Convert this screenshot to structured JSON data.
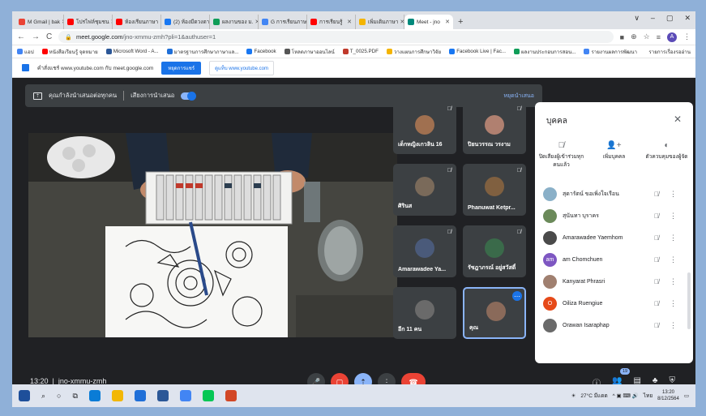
{
  "browser": {
    "tabs": [
      {
        "label": "M Gmail | bak",
        "color": "#ea4335"
      },
      {
        "label": "โปรไฟล์ชุมชน",
        "color": "#ff0000"
      },
      {
        "label": "ห้องเรียนภาษา",
        "color": "#ff0000"
      },
      {
        "label": "(2) ห้องมีดวงดาว",
        "color": "#1877f2"
      },
      {
        "label": "ผลงานของ ม.",
        "color": "#0f9d58"
      },
      {
        "label": "G การเรียนภาษา",
        "color": "#4285f4"
      },
      {
        "label": "การเรียนรู้",
        "color": "#ff0000"
      },
      {
        "label": "เพิ่มเติมภาษา",
        "color": "#f4b400"
      },
      {
        "label": "Meet - jno",
        "color": "#00897b"
      }
    ],
    "new_tab": "+",
    "window_controls": [
      "∨",
      "–",
      "▢",
      "✕"
    ],
    "url_host": "meet.google.com",
    "url_path": "/jno-xmmu-zmh?pli=1&authuser=1",
    "bookmarks": [
      "แอป",
      "หนังสือเรียนรู้ จุดหมาย",
      "Microsoft Word - A...",
      "มาตรฐานการศึกษาภาษาแล...",
      "Facebook",
      "โหลดภาษาออนไลน์",
      "T_0025.PDF",
      "วางแผนการศึกษาวิจัย",
      "Facebook Live | Fac...",
      "ผลงานประกอบการสอน...",
      "รายงานผลการพัฒนา"
    ],
    "reading_list": "รายการเรื่องรออ่าน",
    "infobar": {
      "text": "คำสั่งแชร์ www.youtube.com กับ meet.google.com",
      "switch_label": "หยุดการแชร์",
      "link_label": "ดูแท็บ www.youtube.com"
    }
  },
  "meet": {
    "presenting_text": "คุณกำลังนำเสนอต่อทุกคน",
    "present_option": "เสียงการนำเสนอ",
    "stop_label": "หยุดนำเสนอ",
    "tiles": [
      {
        "name": "เด็กหญิงเกวลิน 16",
        "color": "#a07050"
      },
      {
        "name": "ปิยนวรรณ วรงาม",
        "color": "#b08070"
      },
      {
        "name": "ศิรินส",
        "color": "#7a6a5a"
      },
      {
        "name": "Phanuwat Ketpr...",
        "color": "#806040"
      },
      {
        "name": "Amarawadee Ya...",
        "color": "#4a5a7a"
      },
      {
        "name": "รัชฎาภรณ์ อยู่สวัสดิ์",
        "color": "#3a6a4a"
      },
      {
        "name": "อีก 11 คน",
        "color": "#6a6a6a"
      },
      {
        "name": "คุณ",
        "color": "#8a6a5a"
      }
    ],
    "meeting_time": "13:20",
    "meeting_code": "jno-xmmu-zmh",
    "participant_count": "19"
  },
  "people_panel": {
    "title": "บุคคล",
    "actions": [
      {
        "label": "ปิดเสียงผู้เข้าร่วมทุกคนแล้ว",
        "icon": "mic-off-icon"
      },
      {
        "label": "เพิ่มบุคคล",
        "icon": "add-person-icon"
      },
      {
        "label": "ตัวควบคุมของผู้จัด",
        "icon": "toggle-icon"
      }
    ],
    "participants": [
      {
        "name": "สุดารัตน์ ขอเพิ่งใจเรือน",
        "initial": "",
        "color": "#8ab0c8"
      },
      {
        "name": "สุนันทา บุราคร",
        "initial": "",
        "color": "#6b8a5a"
      },
      {
        "name": "Amarawadee Yaemhom",
        "initial": "",
        "color": "#4a4a4a"
      },
      {
        "name": "am Chomchuen",
        "initial": "am",
        "color": "#7e57c2"
      },
      {
        "name": "Kanyarat Phrasri",
        "initial": "",
        "color": "#a08070"
      },
      {
        "name": "Oiliza Ruengiue",
        "initial": "O",
        "color": "#e64a19"
      },
      {
        "name": "Orawan Isaraphap",
        "initial": "",
        "color": "#6a6a6a"
      }
    ]
  },
  "taskbar": {
    "weather": "27°C มีแดด",
    "language": "ไทย",
    "time": "13:20",
    "date": "8/12/2564"
  }
}
